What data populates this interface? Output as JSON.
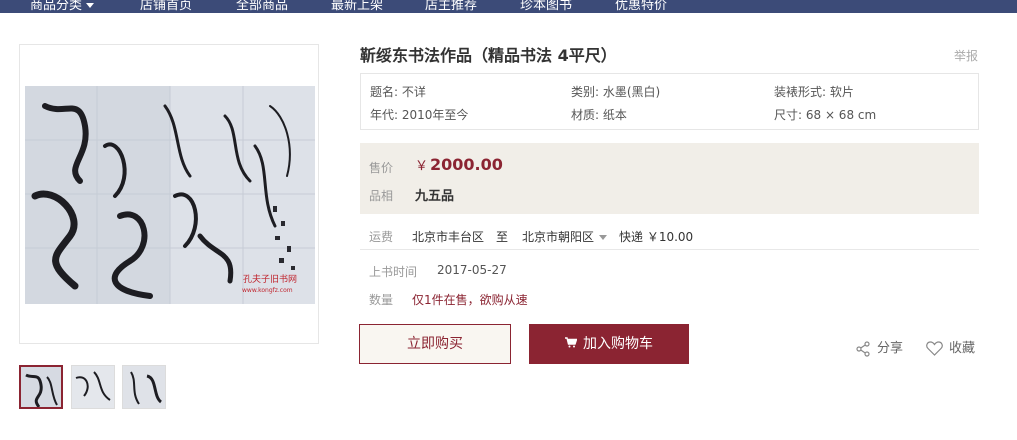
{
  "nav": {
    "items": [
      "商品分类",
      "店铺首页",
      "全部商品",
      "最新上架",
      "店主推荐",
      "珍本图书",
      "优惠特价"
    ]
  },
  "product": {
    "title": "靳绥东书法作品（精品书法 4平尺）",
    "report": "举报",
    "watermark": "孔夫子旧书网",
    "watermark_url": "www.kongfz.com"
  },
  "attributes": {
    "title_field": "题名: 不详",
    "category": "类别: 水墨(黑白)",
    "binding": "装裱形式: 软片",
    "era": "年代: 2010年至今",
    "material": "材质: 纸本",
    "size": "尺寸: 68 × 68 cm"
  },
  "price": {
    "label": "售价",
    "currency": "￥",
    "value": "2000.00",
    "condition_label": "品相",
    "condition": "九五品"
  },
  "shipping": {
    "label": "运费",
    "from": "北京市丰台区",
    "to_word": "至",
    "to": "北京市朝阳区",
    "method": "快递 ￥10.00"
  },
  "listing": {
    "date_label": "上书时间",
    "date": "2017-05-27",
    "qty_label": "数量",
    "qty_text": "仅1件在售，欲购从速"
  },
  "actions": {
    "buy_now": "立即购买",
    "add_to_cart": "加入购物车",
    "share": "分享",
    "favorite": "收藏"
  },
  "colors": {
    "accent": "#8b2432",
    "nav_bg": "#3c4b78",
    "price_bg": "#f1eee8"
  }
}
